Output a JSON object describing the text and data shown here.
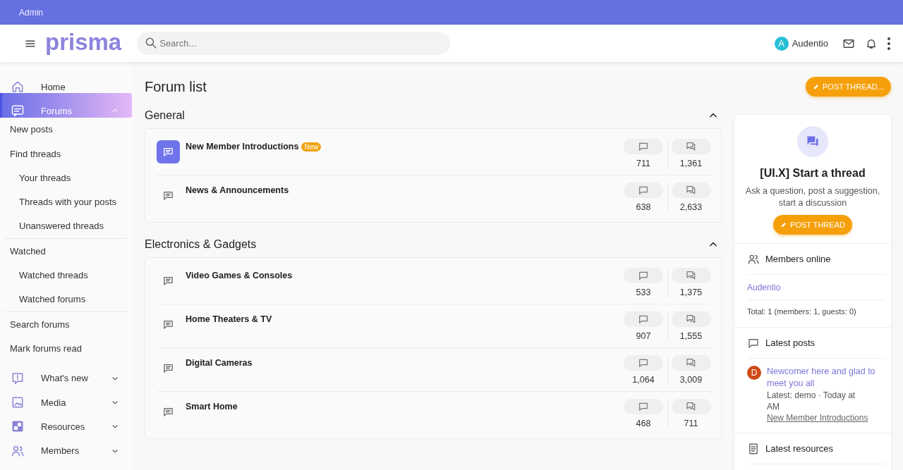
{
  "admin_bar": {
    "label": "Admin"
  },
  "header": {
    "logo": "prisma",
    "search": {
      "placeholder": "Search..."
    },
    "user": {
      "initial": "A",
      "name": "Audentio"
    }
  },
  "sidebar": {
    "items": [
      {
        "label": "Home",
        "kind": "main",
        "selected": false
      },
      {
        "label": "Forums",
        "kind": "main",
        "selected": true,
        "expanded": true
      },
      {
        "label": "New posts",
        "kind": "link",
        "selected": false
      },
      {
        "label": "Find threads",
        "kind": "link",
        "selected": false
      },
      {
        "label": "Your threads",
        "kind": "sub",
        "selected": false
      },
      {
        "label": "Threads with your posts",
        "kind": "sub",
        "selected": false
      },
      {
        "label": "Unanswered threads",
        "kind": "sub",
        "selected": false,
        "divider": true
      },
      {
        "label": "Watched",
        "kind": "link",
        "selected": false
      },
      {
        "label": "Watched threads",
        "kind": "sub",
        "selected": false
      },
      {
        "label": "Watched forums",
        "kind": "sub",
        "selected": false,
        "divider": true
      },
      {
        "label": "Search forums",
        "kind": "link",
        "selected": false
      },
      {
        "label": "Mark forums read",
        "kind": "link",
        "selected": false
      },
      {
        "label": "What's new",
        "kind": "main",
        "selected": false,
        "expanded": false
      },
      {
        "label": "Media",
        "kind": "main",
        "selected": false,
        "expanded": false
      },
      {
        "label": "Resources",
        "kind": "main",
        "selected": false,
        "expanded": false
      },
      {
        "label": "Members",
        "kind": "main",
        "selected": false,
        "expanded": false
      }
    ]
  },
  "main": {
    "title": "Forum list",
    "post_button": "POST THREAD...",
    "categories": [
      {
        "title": "General",
        "expanded": true,
        "forums": [
          {
            "title": "New Member Introductions",
            "badge": "New",
            "unread": true,
            "threads": "711",
            "messages": "1,361"
          },
          {
            "title": "News & Announcements",
            "unread": false,
            "threads": "638",
            "messages": "2,633"
          }
        ]
      },
      {
        "title": "Electronics & Gadgets",
        "expanded": true,
        "forums": [
          {
            "title": "Video Games & Consoles",
            "unread": false,
            "threads": "533",
            "messages": "1,375"
          },
          {
            "title": "Home Theaters & TV",
            "unread": false,
            "threads": "907",
            "messages": "1,555"
          },
          {
            "title": "Digital Cameras",
            "unread": false,
            "threads": "1,064",
            "messages": "3,009"
          },
          {
            "title": "Smart Home",
            "unread": false,
            "threads": "468",
            "messages": "711"
          }
        ]
      }
    ]
  },
  "side": {
    "start": {
      "title": "[UI.X] Start a thread",
      "text": "Ask a question, post a suggestion, start a discussion",
      "button": "POST THREAD"
    },
    "members_online": {
      "title": "Members online",
      "members": [
        "Audentio"
      ],
      "total": "Total: 1 (members: 1, guests: 0)"
    },
    "latest_posts": {
      "title": "Latest posts",
      "posts": [
        {
          "initial": "D",
          "title": "Newcomer here and glad to meet you all",
          "meta": "Latest: demo · Today at",
          "meta_2": "AM",
          "forum": "New Member Introductions"
        }
      ]
    },
    "latest_resources": {
      "title": "Latest resources"
    }
  }
}
